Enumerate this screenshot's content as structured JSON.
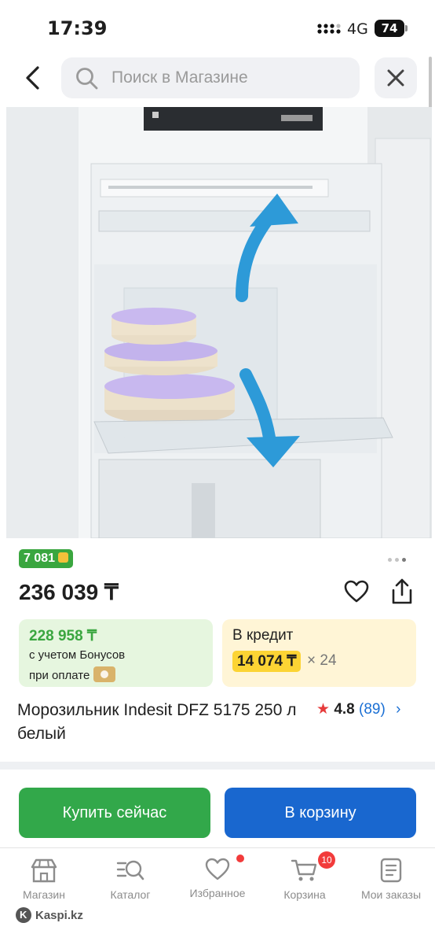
{
  "status_bar": {
    "time": "17:39",
    "network": "4G",
    "battery": "74"
  },
  "search": {
    "placeholder": "Поиск в Магазине"
  },
  "product": {
    "bonus_badge": "7 081",
    "price": "236 039 ₸",
    "title": "Морозильник Indesit DFZ 5175 250 л белый",
    "rating": "4.8",
    "reviews": "(89)",
    "gallery_pages": 3,
    "gallery_current": 3
  },
  "bonus_card": {
    "amount": "228 958 ₸",
    "line1": "с учетом Бонусов",
    "line2": "при оплате"
  },
  "credit_card": {
    "title": "В кредит",
    "monthly": "14 074 ₸",
    "months": "× 24"
  },
  "buttons": {
    "buy_now": "Купить сейчас",
    "to_cart": "В корзину"
  },
  "tabs": [
    {
      "label": "Магазин",
      "icon": "store-icon"
    },
    {
      "label": "Каталог",
      "icon": "catalog-search-icon"
    },
    {
      "label": "Избранное",
      "icon": "heart-icon"
    },
    {
      "label": "Корзина",
      "icon": "cart-icon",
      "badge": "10"
    },
    {
      "label": "Мои заказы",
      "icon": "orders-icon"
    }
  ],
  "brand": "Kaspi.kz",
  "colors": {
    "green": "#32a84a",
    "blue": "#1967cf",
    "red": "#f23b3b",
    "yellow": "#fcd434"
  }
}
